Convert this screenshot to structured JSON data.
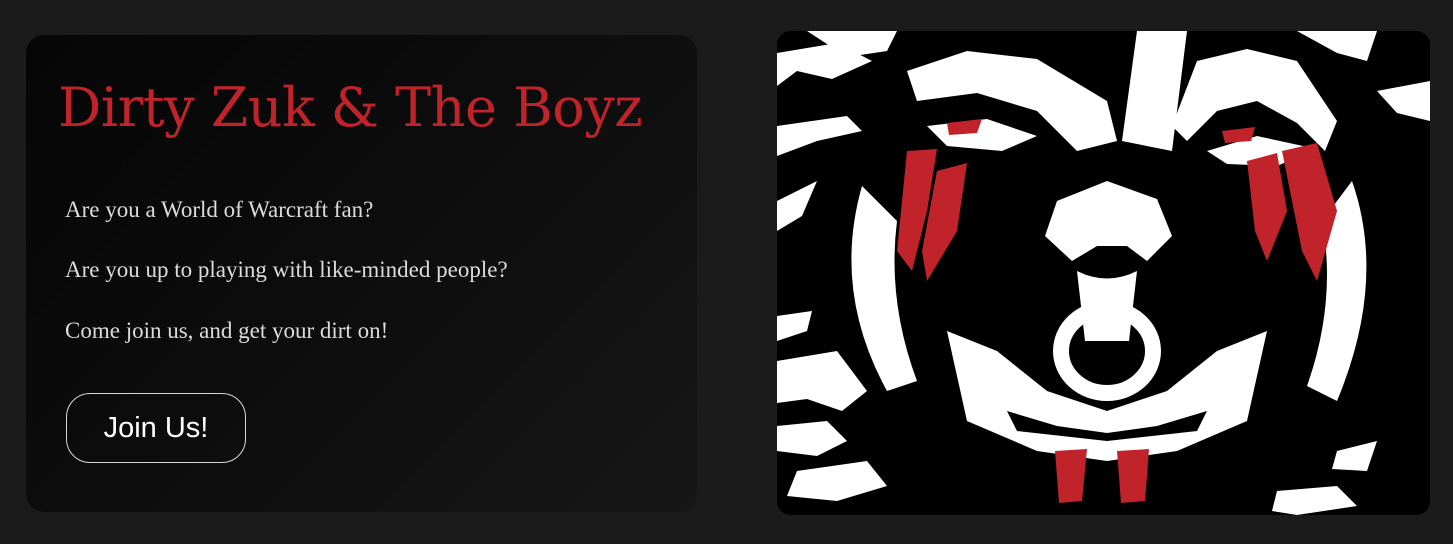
{
  "hero": {
    "title": "Dirty Zuk & The Boyz",
    "lines": [
      "Are you a World of Warcraft fan?",
      "Are you up to playing with like-minded people?",
      "Come join us, and get your dirt on!"
    ],
    "join_label": "Join Us!"
  },
  "image": {
    "icon": "orc-face-icon"
  },
  "colors": {
    "background": "#1b1b1b",
    "accent_red": "#c1232b",
    "text": "#dcdcdc"
  }
}
